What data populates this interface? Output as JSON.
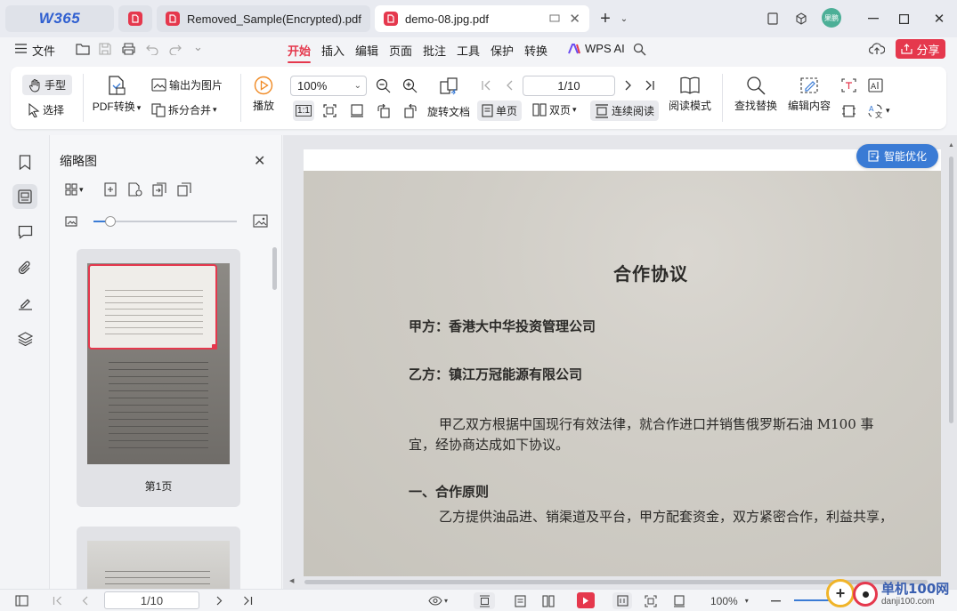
{
  "app": {
    "logo": "W365"
  },
  "tabs": [
    {
      "title": "Removed_Sample(Encrypted).pdf",
      "active": false
    },
    {
      "title": "demo-08.jpg.pdf",
      "active": true
    }
  ],
  "user": {
    "avatar_text": "果鹏"
  },
  "menubar": {
    "file_label": "文件",
    "items": [
      "开始",
      "插入",
      "编辑",
      "页面",
      "批注",
      "工具",
      "保护",
      "转换"
    ],
    "active": "开始",
    "wps_ai": "WPS AI",
    "share_label": "分享"
  },
  "toolbar": {
    "hand": "手型",
    "select": "选择",
    "pdf_convert": "PDF转换",
    "export_image": "输出为图片",
    "split_merge": "拆分合并",
    "play": "播放",
    "zoom_value": "100%",
    "page_value": "1/10",
    "rotate_doc": "旋转文档",
    "single_page": "单页",
    "double_page": "双页",
    "continuous": "连续阅读",
    "read_mode": "阅读模式",
    "find_replace": "查找替换",
    "edit_content": "编辑内容",
    "fit_label": "1:1"
  },
  "panel": {
    "title": "缩略图",
    "zoom_level": 0.12,
    "thumbnail_label": "第1页"
  },
  "smart_optimize": "智能优化",
  "document": {
    "title": "合作协议",
    "party_a": "甲方：香港大中华投资管理公司",
    "party_b": "乙方：镇江万冠能源有限公司",
    "para1_line1": "甲乙双方根据中国现行有效法律，就合作进口并销售俄罗斯石油 M100 事",
    "para1_line2": "宜，经协商达成如下协议。",
    "section1": "一、合作原则",
    "section1_line1": "乙方提供油品进、销渠道及平台，甲方配套资金，双方紧密合作，利益共享，"
  },
  "statusbar": {
    "page_value": "1/10",
    "zoom_value": "100%"
  },
  "watermark": {
    "text1": "单机100网",
    "text2": "danji100.com"
  },
  "colors": {
    "accent": "#e5384d",
    "blue": "#3a7bd5"
  }
}
